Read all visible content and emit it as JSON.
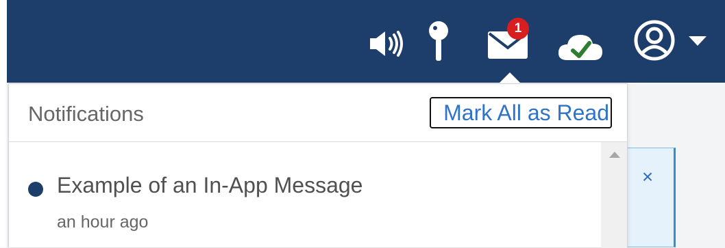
{
  "topbar": {
    "icons": {
      "announcements": "megaphone-icon",
      "pin": "pin-icon",
      "messages": "envelope-icon",
      "sync": "cloud-check-icon",
      "profile": "user-avatar-icon",
      "profile_menu": "caret-down-icon"
    },
    "messages_badge": "1",
    "colors": {
      "bar": "#1d3d6b",
      "badge": "#d81e1e",
      "check": "#2e7d32"
    }
  },
  "notifications": {
    "title": "Notifications",
    "mark_all_label": "Mark All as Read",
    "items": [
      {
        "title": "Example of an In-App Message",
        "time": "an hour ago",
        "unread": true
      }
    ]
  },
  "alert": {
    "close_label": "×"
  }
}
